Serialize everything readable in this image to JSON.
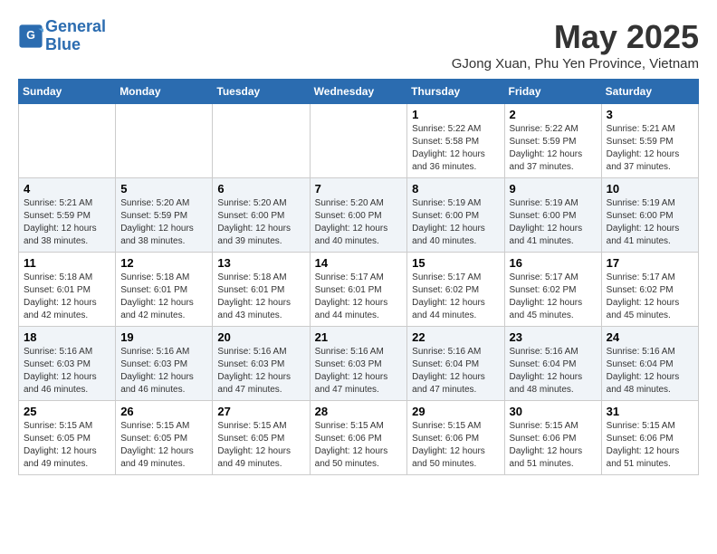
{
  "logo": {
    "line1": "General",
    "line2": "Blue"
  },
  "title": "May 2025",
  "subtitle": "GJong Xuan, Phu Yen Province, Vietnam",
  "days_of_week": [
    "Sunday",
    "Monday",
    "Tuesday",
    "Wednesday",
    "Thursday",
    "Friday",
    "Saturday"
  ],
  "weeks": [
    [
      {
        "day": "",
        "info": ""
      },
      {
        "day": "",
        "info": ""
      },
      {
        "day": "",
        "info": ""
      },
      {
        "day": "",
        "info": ""
      },
      {
        "day": "1",
        "info": "Sunrise: 5:22 AM\nSunset: 5:58 PM\nDaylight: 12 hours\nand 36 minutes."
      },
      {
        "day": "2",
        "info": "Sunrise: 5:22 AM\nSunset: 5:59 PM\nDaylight: 12 hours\nand 37 minutes."
      },
      {
        "day": "3",
        "info": "Sunrise: 5:21 AM\nSunset: 5:59 PM\nDaylight: 12 hours\nand 37 minutes."
      }
    ],
    [
      {
        "day": "4",
        "info": "Sunrise: 5:21 AM\nSunset: 5:59 PM\nDaylight: 12 hours\nand 38 minutes."
      },
      {
        "day": "5",
        "info": "Sunrise: 5:20 AM\nSunset: 5:59 PM\nDaylight: 12 hours\nand 38 minutes."
      },
      {
        "day": "6",
        "info": "Sunrise: 5:20 AM\nSunset: 6:00 PM\nDaylight: 12 hours\nand 39 minutes."
      },
      {
        "day": "7",
        "info": "Sunrise: 5:20 AM\nSunset: 6:00 PM\nDaylight: 12 hours\nand 40 minutes."
      },
      {
        "day": "8",
        "info": "Sunrise: 5:19 AM\nSunset: 6:00 PM\nDaylight: 12 hours\nand 40 minutes."
      },
      {
        "day": "9",
        "info": "Sunrise: 5:19 AM\nSunset: 6:00 PM\nDaylight: 12 hours\nand 41 minutes."
      },
      {
        "day": "10",
        "info": "Sunrise: 5:19 AM\nSunset: 6:00 PM\nDaylight: 12 hours\nand 41 minutes."
      }
    ],
    [
      {
        "day": "11",
        "info": "Sunrise: 5:18 AM\nSunset: 6:01 PM\nDaylight: 12 hours\nand 42 minutes."
      },
      {
        "day": "12",
        "info": "Sunrise: 5:18 AM\nSunset: 6:01 PM\nDaylight: 12 hours\nand 42 minutes."
      },
      {
        "day": "13",
        "info": "Sunrise: 5:18 AM\nSunset: 6:01 PM\nDaylight: 12 hours\nand 43 minutes."
      },
      {
        "day": "14",
        "info": "Sunrise: 5:17 AM\nSunset: 6:01 PM\nDaylight: 12 hours\nand 44 minutes."
      },
      {
        "day": "15",
        "info": "Sunrise: 5:17 AM\nSunset: 6:02 PM\nDaylight: 12 hours\nand 44 minutes."
      },
      {
        "day": "16",
        "info": "Sunrise: 5:17 AM\nSunset: 6:02 PM\nDaylight: 12 hours\nand 45 minutes."
      },
      {
        "day": "17",
        "info": "Sunrise: 5:17 AM\nSunset: 6:02 PM\nDaylight: 12 hours\nand 45 minutes."
      }
    ],
    [
      {
        "day": "18",
        "info": "Sunrise: 5:16 AM\nSunset: 6:03 PM\nDaylight: 12 hours\nand 46 minutes."
      },
      {
        "day": "19",
        "info": "Sunrise: 5:16 AM\nSunset: 6:03 PM\nDaylight: 12 hours\nand 46 minutes."
      },
      {
        "day": "20",
        "info": "Sunrise: 5:16 AM\nSunset: 6:03 PM\nDaylight: 12 hours\nand 47 minutes."
      },
      {
        "day": "21",
        "info": "Sunrise: 5:16 AM\nSunset: 6:03 PM\nDaylight: 12 hours\nand 47 minutes."
      },
      {
        "day": "22",
        "info": "Sunrise: 5:16 AM\nSunset: 6:04 PM\nDaylight: 12 hours\nand 47 minutes."
      },
      {
        "day": "23",
        "info": "Sunrise: 5:16 AM\nSunset: 6:04 PM\nDaylight: 12 hours\nand 48 minutes."
      },
      {
        "day": "24",
        "info": "Sunrise: 5:16 AM\nSunset: 6:04 PM\nDaylight: 12 hours\nand 48 minutes."
      }
    ],
    [
      {
        "day": "25",
        "info": "Sunrise: 5:15 AM\nSunset: 6:05 PM\nDaylight: 12 hours\nand 49 minutes."
      },
      {
        "day": "26",
        "info": "Sunrise: 5:15 AM\nSunset: 6:05 PM\nDaylight: 12 hours\nand 49 minutes."
      },
      {
        "day": "27",
        "info": "Sunrise: 5:15 AM\nSunset: 6:05 PM\nDaylight: 12 hours\nand 49 minutes."
      },
      {
        "day": "28",
        "info": "Sunrise: 5:15 AM\nSunset: 6:06 PM\nDaylight: 12 hours\nand 50 minutes."
      },
      {
        "day": "29",
        "info": "Sunrise: 5:15 AM\nSunset: 6:06 PM\nDaylight: 12 hours\nand 50 minutes."
      },
      {
        "day": "30",
        "info": "Sunrise: 5:15 AM\nSunset: 6:06 PM\nDaylight: 12 hours\nand 51 minutes."
      },
      {
        "day": "31",
        "info": "Sunrise: 5:15 AM\nSunset: 6:06 PM\nDaylight: 12 hours\nand 51 minutes."
      }
    ]
  ]
}
